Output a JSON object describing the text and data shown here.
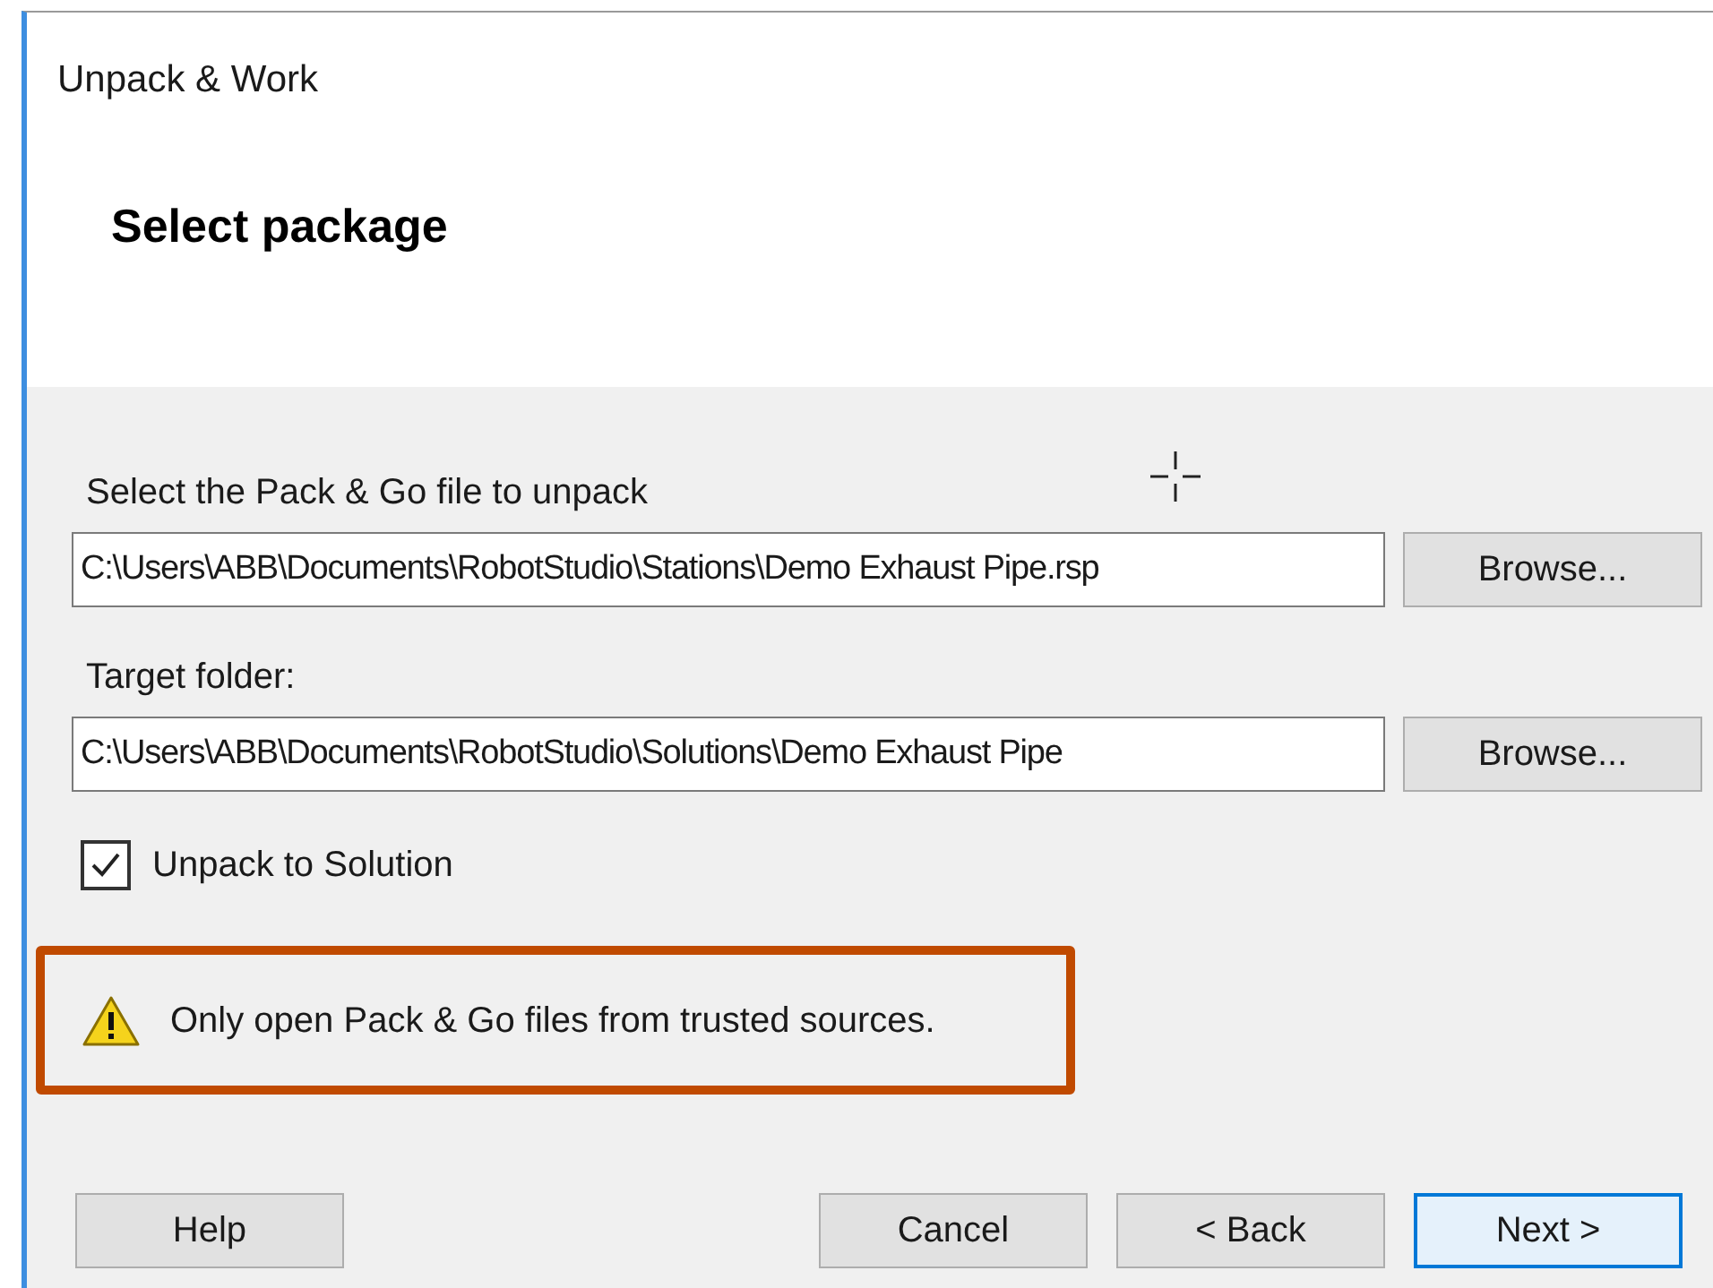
{
  "window": {
    "title": "Unpack & Work"
  },
  "heading": "Select package",
  "fields": [
    {
      "label": "Select the Pack & Go file to unpack",
      "value": "C:\\Users\\ABB\\Documents\\RobotStudio\\Stations\\Demo Exhaust Pipe.rsp",
      "button": "Browse..."
    },
    {
      "label": "Target folder:",
      "value": "C:\\Users\\ABB\\Documents\\RobotStudio\\Solutions\\Demo Exhaust Pipe",
      "button": "Browse..."
    }
  ],
  "unpack_to_solution": {
    "label": "Unpack to Solution",
    "checked": true
  },
  "warning": {
    "text": "Only open Pack & Go files from trusted sources.",
    "highlighted": true
  },
  "left_buttons": [
    {
      "label": "Help",
      "focused": false
    }
  ],
  "right_buttons": [
    {
      "label": "Cancel",
      "focused": false
    },
    {
      "label": "< Back",
      "focused": false
    },
    {
      "label": "Next >",
      "focused": true
    }
  ]
}
